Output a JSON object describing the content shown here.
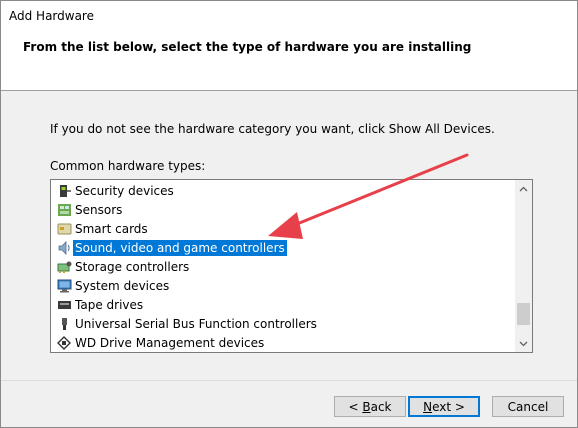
{
  "window": {
    "title": "Add Hardware"
  },
  "header": {
    "subtitle": "From the list below, select the type of hardware you are installing"
  },
  "main": {
    "hint": "If you do not see the hardware category you want, click Show All Devices.",
    "list_label": "Common hardware types:",
    "items": [
      {
        "label": "Security devices",
        "icon": "security-devices-icon",
        "selected": false
      },
      {
        "label": "Sensors",
        "icon": "sensors-icon",
        "selected": false
      },
      {
        "label": "Smart cards",
        "icon": "smart-card-icon",
        "selected": false
      },
      {
        "label": "Sound, video and game controllers",
        "icon": "speaker-icon",
        "selected": true
      },
      {
        "label": "Storage controllers",
        "icon": "storage-controller-icon",
        "selected": false
      },
      {
        "label": "System devices",
        "icon": "system-devices-icon",
        "selected": false
      },
      {
        "label": "Tape drives",
        "icon": "tape-drive-icon",
        "selected": false
      },
      {
        "label": "Universal Serial Bus Function controllers",
        "icon": "usb-icon",
        "selected": false
      },
      {
        "label": "WD Drive Management devices",
        "icon": "wd-drive-icon",
        "selected": false
      }
    ]
  },
  "footer": {
    "back_prefix": "< ",
    "back_key": "B",
    "back_rest": "ack",
    "next_key": "N",
    "next_rest": "ext >",
    "cancel_label": "Cancel"
  },
  "colors": {
    "selection": "#0078d7",
    "annotation_arrow": "#e8404a"
  }
}
